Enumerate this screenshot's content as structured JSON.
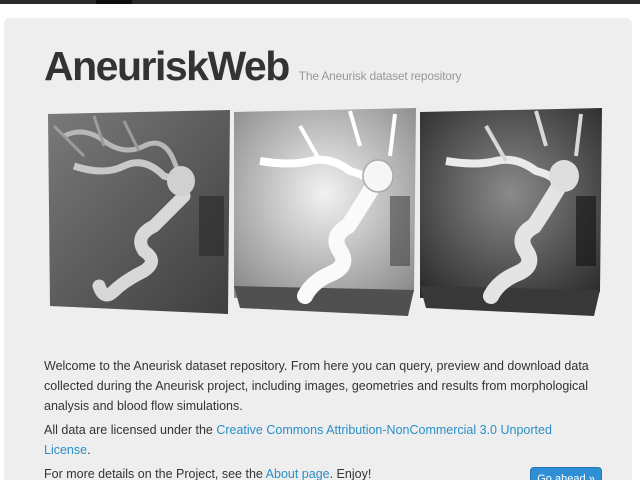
{
  "header": {
    "title": "AneuriskWeb",
    "subtitle": "The Aneurisk dataset repository"
  },
  "images": [
    {
      "name": "angiography-volume-panel",
      "style": "mip"
    },
    {
      "name": "segmentation-render-panel",
      "style": "isosurface"
    },
    {
      "name": "dark-render-panel",
      "style": "isosurface-dark"
    }
  ],
  "intro": {
    "welcome": "Welcome to the Aneurisk dataset repository. From here you can query, preview and download data collected during the Aneurisk project, including images, geometries and results from morphological analysis and blood flow simulations.",
    "license_prefix": "All data are licensed under the ",
    "license_link": "Creative Commons Attribution-NonCommercial 3.0 Unported License",
    "license_suffix": ".",
    "details_prefix": "For more details on the Project, see the ",
    "details_link": "About page",
    "details_suffix": ". Enjoy!"
  },
  "actions": {
    "go_ahead": "Go ahead »"
  },
  "colors": {
    "link": "#2a8fc7",
    "button": "#2f8fd5",
    "title": "#333333"
  }
}
